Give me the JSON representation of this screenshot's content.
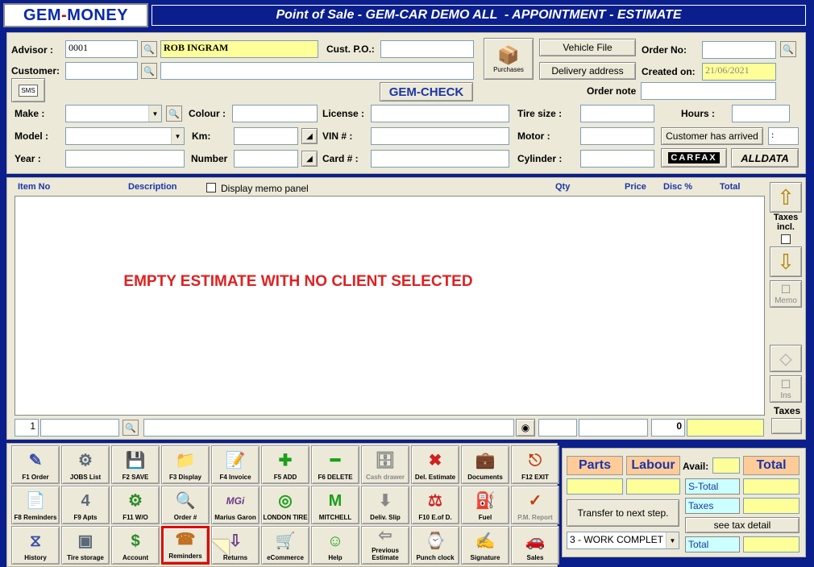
{
  "app": {
    "logo": "GEM-MONEY",
    "title": "Point of Sale - GEM-CAR DEMO ALL  - APPOINTMENT - ESTIMATE"
  },
  "header": {
    "advisor_label": "Advisor :",
    "advisor_code": "0001",
    "advisor_name": "ROB INGRAM",
    "cust_po_label": "Cust. P.O.:",
    "customer_label": "Customer:",
    "purchases_label": "Purchases",
    "vehicle_file_label": "Vehicle File",
    "delivery_address_label": "Delivery address",
    "order_no_label": "Order No:",
    "created_on_label": "Created on:",
    "created_on": "21/06/2021",
    "order_note_label": "Order note",
    "gemcheck_label": "GEM-CHECK",
    "sms_label": "SMS",
    "make_label": "Make :",
    "colour_label": "Colour :",
    "license_label": "License :",
    "tire_size_label": "Tire size :",
    "hours_label": "Hours :",
    "model_label": "Model :",
    "km_label": "Km:",
    "vin_label": "VIN # :",
    "motor_label": "Motor :",
    "customer_arrived_label": "Customer has arrived",
    "colon": ":",
    "year_label": "Year :",
    "number_label": "Number",
    "card_label": "Card # :",
    "cylinder_label": "Cylinder :",
    "carfax_label": "CARFAX",
    "alldata_label": "ALLDATA"
  },
  "grid": {
    "columns": {
      "item_no": "Item No",
      "description": "Description",
      "memo": "Display memo panel",
      "qty": "Qty",
      "price": "Price",
      "disc": "Disc %",
      "total": "Total"
    },
    "empty_message": "EMPTY ESTIMATE WITH NO CLIENT SELECTED",
    "side": {
      "taxes_incl": "Taxes incl.",
      "memo": "Memo",
      "ins": "Ins",
      "taxes": "Taxes"
    },
    "footer": {
      "line_no": "1",
      "total_qty": "0"
    }
  },
  "toolbar": [
    [
      {
        "label": "F1 Order",
        "icon": "✎"
      },
      {
        "label": "JOBS List",
        "icon": "⚙"
      },
      {
        "label": "F2 SAVE",
        "icon": "💾"
      },
      {
        "label": "F3 Display",
        "icon": "📁"
      },
      {
        "label": "F4 Invoice",
        "icon": "📝"
      },
      {
        "label": "F5 ADD",
        "icon": "✚"
      },
      {
        "label": "F6 DELETE",
        "icon": "━"
      },
      {
        "label": "Cash drawer",
        "icon": "🗄"
      },
      {
        "label": "Del. Estimate",
        "icon": "✖"
      },
      {
        "label": "Documents",
        "icon": "💼"
      },
      {
        "label": "F12 EXIT",
        "icon": "⎋"
      }
    ],
    [
      {
        "label": "F8 Reminders",
        "icon": "📄"
      },
      {
        "label": "F9 Apts",
        "icon": "4"
      },
      {
        "label": "F11 W/O",
        "icon": "⚙"
      },
      {
        "label": "Order #",
        "icon": "🔍"
      },
      {
        "label": "Marius Garon",
        "icon": "MGi"
      },
      {
        "label": "LONDON TIRE",
        "icon": "◎"
      },
      {
        "label": "MITCHELL",
        "icon": "M"
      },
      {
        "label": "Deliv. Slip",
        "icon": "⬇"
      },
      {
        "label": "F10 E.of D.",
        "icon": "⚖"
      },
      {
        "label": "Fuel",
        "icon": "⛽"
      },
      {
        "label": "P.M. Report",
        "icon": "✓"
      }
    ],
    [
      {
        "label": "History",
        "icon": "⧖"
      },
      {
        "label": "Tire storage",
        "icon": "▣"
      },
      {
        "label": "Account",
        "icon": "$"
      },
      {
        "label": "Reminders",
        "icon": "☎"
      },
      {
        "label": "Returns",
        "icon": "⇩"
      },
      {
        "label": "eCommerce",
        "icon": "🛒"
      },
      {
        "label": "Help",
        "icon": "☺"
      },
      {
        "label": "Previous Estimate",
        "icon": "⇦"
      },
      {
        "label": "Punch clock",
        "icon": "⌚"
      },
      {
        "label": "Signature",
        "icon": "✍"
      },
      {
        "label": "Sales",
        "icon": "🚗"
      }
    ]
  ],
  "summary": {
    "parts": "Parts",
    "labour": "Labour",
    "avail": "Avail:",
    "total_head": "Total",
    "stotal": "S-Total",
    "taxes": "Taxes",
    "transfer": "Transfer to next step.",
    "see_tax": "see tax detail",
    "step": "3 - WORK COMPLET",
    "total": "Total"
  }
}
